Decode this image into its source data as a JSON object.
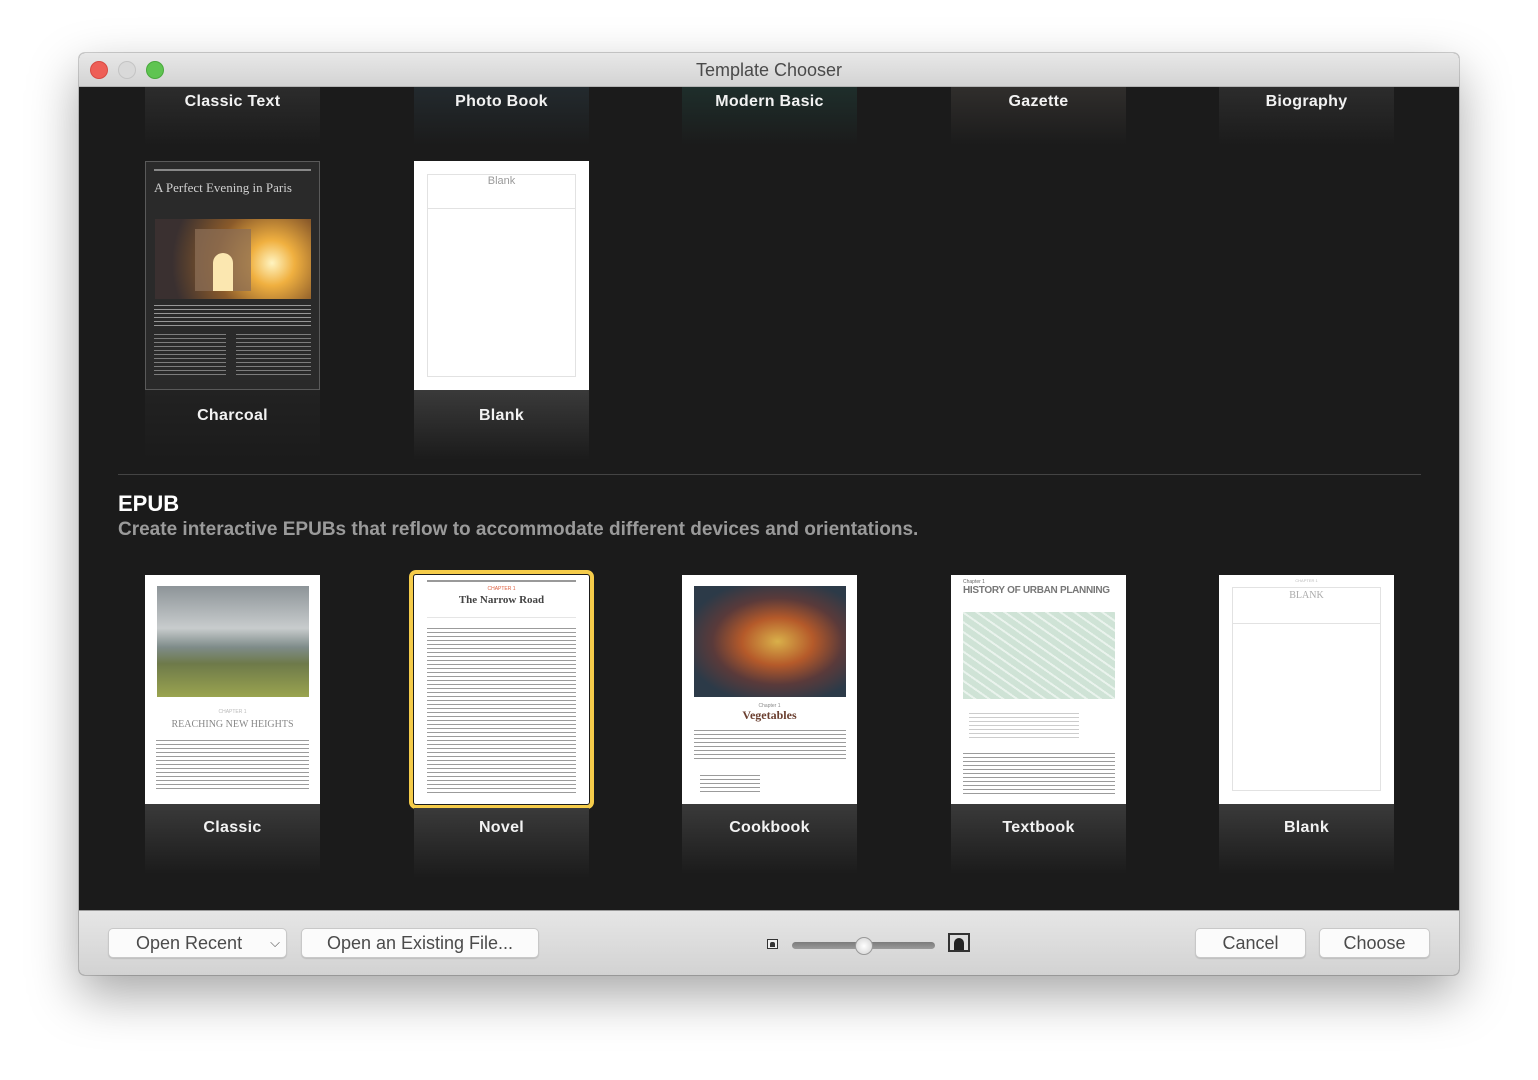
{
  "window": {
    "title": "Template Chooser"
  },
  "top_row": {
    "templates": [
      {
        "label": "Classic Text"
      },
      {
        "label": "Photo Book"
      },
      {
        "label": "Modern Basic"
      },
      {
        "label": "Gazette"
      },
      {
        "label": "Biography"
      }
    ]
  },
  "second_row": {
    "templates": [
      {
        "label": "Charcoal",
        "preview_title": "A Perfect Evening in Paris"
      },
      {
        "label": "Blank",
        "preview_title": "Blank"
      }
    ]
  },
  "epub_section": {
    "title": "EPUB",
    "description": "Create interactive EPUBs that reflow to accommodate different devices and orientations.",
    "templates": [
      {
        "label": "Classic",
        "preview_title": "REACHING NEW HEIGHTS",
        "preview_chapter": "CHAPTER 1",
        "selected": false
      },
      {
        "label": "Novel",
        "preview_title": "The Narrow Road",
        "preview_chapter": "CHAPTER 1",
        "selected": true
      },
      {
        "label": "Cookbook",
        "preview_title": "Vegetables",
        "preview_chapter": "Chapter 1",
        "selected": false
      },
      {
        "label": "Textbook",
        "preview_title": "HISTORY OF URBAN PLANNING",
        "preview_chapter": "Chapter 1",
        "selected": false
      },
      {
        "label": "Blank",
        "preview_title": "BLANK",
        "preview_chapter": "CHAPTER 1",
        "selected": false
      }
    ]
  },
  "bottom_bar": {
    "open_recent_label": "Open Recent",
    "open_existing_label": "Open an Existing File...",
    "cancel_label": "Cancel",
    "choose_label": "Choose",
    "thumbnail_size_slider": {
      "value_percent": 50
    }
  },
  "colors": {
    "selection_accent": "#f5cc4a",
    "content_background": "#1b1b1b"
  }
}
